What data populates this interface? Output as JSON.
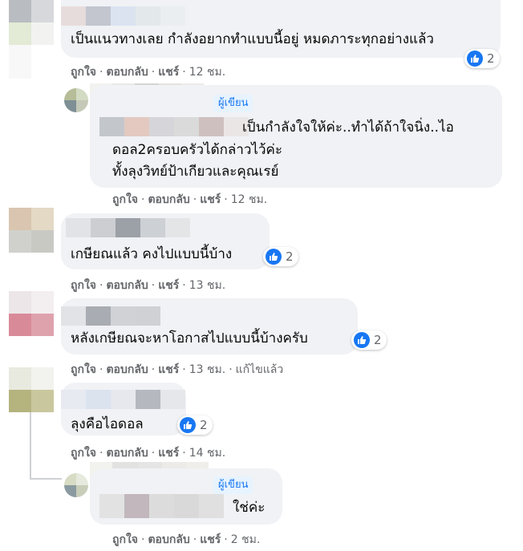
{
  "comments": [
    {
      "text_lines": [
        "เป็นแนวทางเลย กำลังอยากทำแบบนี้อยู่ หมดภาระทุกอย่างแล้ว"
      ],
      "reaction_count": "2",
      "actions": {
        "like": "ถูกใจ",
        "reply": "ตอบกลับ",
        "share": "แชร์",
        "time": "12 ชม."
      }
    },
    {
      "author_badge": "ผู้เขียน",
      "text_lines": [
        "เป็นกำลังใจให้ค่ะ..ทำได้ถ้าใจนิ่ง..ไอ",
        "ดอล2ครอบครัวได้กล่าวไว้ค่ะ",
        "ทั้งลุงวิทย์ป้าเกียวและคุณเรย์"
      ],
      "actions": {
        "like": "ถูกใจ",
        "reply": "ตอบกลับ",
        "share": "แชร์",
        "time": "12 ชม."
      }
    },
    {
      "text_lines": [
        "เกษียณแล้ว คงไปแบบนี้บ้าง"
      ],
      "reaction_count": "2",
      "actions": {
        "like": "ถูกใจ",
        "reply": "ตอบกลับ",
        "share": "แชร์",
        "time": "13 ชม."
      }
    },
    {
      "text_lines": [
        "หลังเกษียณจะหาโอกาสไปแบบนี้บ้างครับ"
      ],
      "reaction_count": "2",
      "actions": {
        "like": "ถูกใจ",
        "reply": "ตอบกลับ",
        "share": "แชร์",
        "time": "13 ชม.",
        "edited": "แก้ไขแล้ว"
      }
    },
    {
      "text_lines": [
        "ลุงคือไอดอล"
      ],
      "reaction_count": "2",
      "actions": {
        "like": "ถูกใจ",
        "reply": "ตอบกลับ",
        "share": "แชร์",
        "time": "14 ชม."
      }
    },
    {
      "author_badge": "ผู้เขียน",
      "text_lines": [
        "ใช่ค่ะ"
      ],
      "actions": {
        "like": "ถูกใจ",
        "reply": "ตอบกลับ",
        "share": "แชร์",
        "time": "2 ชม."
      }
    }
  ],
  "separator": "·",
  "icons": {
    "reaction": "like-icon"
  },
  "colors": {
    "bubble": "#f0f2f5",
    "link": "#65676b",
    "like_blue": "#1877f2",
    "badge_bg": "#e7f3ff"
  }
}
